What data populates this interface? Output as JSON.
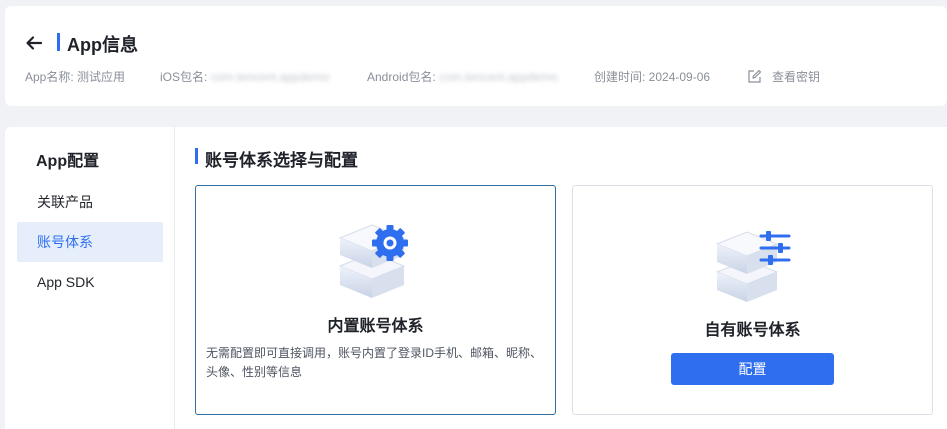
{
  "header": {
    "back_icon": "arrow-left-icon",
    "title": "App信息",
    "app_name_label": "App名称: 测试应用",
    "ios_label": "iOS包名:",
    "ios_value": "com.tencent.appdemo",
    "android_label": "Android包名:",
    "android_value": "com.tencent.appdemo",
    "created_label": "创建时间: 2024-09-06",
    "view_key_icon": "edit-icon",
    "view_key_label": "查看密钥"
  },
  "sidebar": {
    "title": "App配置",
    "items": [
      {
        "label": "关联产品",
        "active": false
      },
      {
        "label": "账号体系",
        "active": true
      },
      {
        "label": "App SDK",
        "active": false
      }
    ]
  },
  "main": {
    "section_title": "账号体系选择与配置",
    "cards": [
      {
        "name": "内置账号体系",
        "icon": "server-gear-icon",
        "description": "无需配置即可直接调用，账号内置了登录ID手机、邮箱、昵称、头像、性别等信息",
        "selected": true
      },
      {
        "name": "自有账号体系",
        "icon": "server-sliders-icon",
        "button_label": "配置",
        "selected": false
      }
    ]
  },
  "colors": {
    "accent": "#2f6fef",
    "selected_border": "#2e6d9e",
    "active_bg": "#e6eefc",
    "page_bg": "#f1f2f5"
  }
}
